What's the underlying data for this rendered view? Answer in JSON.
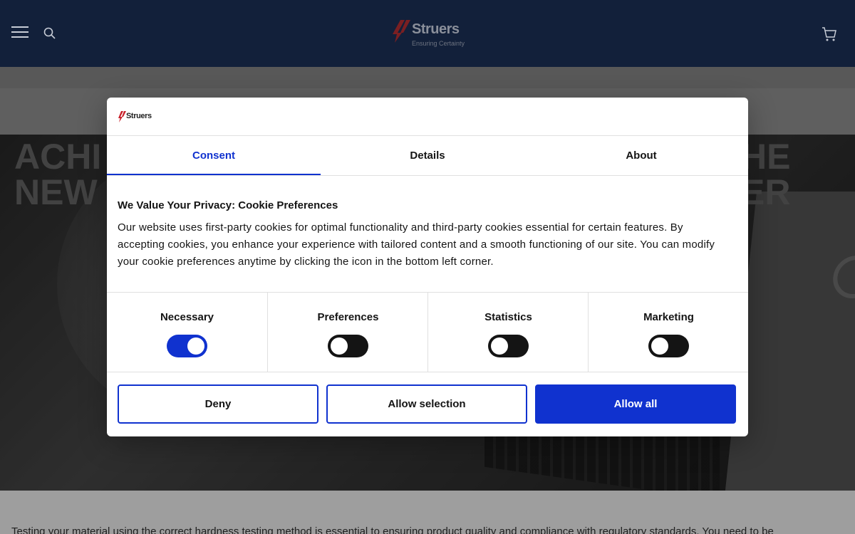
{
  "header": {
    "brand_name": "Struers",
    "brand_tagline": "Ensuring Certainty",
    "menu_icon": "hamburger-menu-icon",
    "search_icon": "search-icon",
    "cart_icon": "shopping-cart-icon",
    "background_color": "#12203a"
  },
  "hero": {
    "title_left_line1": "ACHI",
    "title_left_line2": "NEW",
    "title_right_line1": "HE",
    "title_right_line2": "ER"
  },
  "intro_text": "Testing your material using the correct hardness testing method is essential to ensuring product quality and compliance with regulatory standards. You need to be",
  "consent_dialog": {
    "logo_text": "Struers",
    "tabs": [
      {
        "label": "Consent",
        "active": true
      },
      {
        "label": "Details",
        "active": false
      },
      {
        "label": "About",
        "active": false
      }
    ],
    "title": "We Value Your Privacy: Cookie Preferences",
    "body": "Our website uses first-party cookies for optimal functionality and third-party cookies essential for certain features. By accepting cookies, you enhance your experience with tailored content and a smooth functioning of our site. You can modify your cookie preferences anytime by clicking the icon in the bottom left corner.",
    "categories": [
      {
        "label": "Necessary",
        "checked": true
      },
      {
        "label": "Preferences",
        "checked": false
      },
      {
        "label": "Statistics",
        "checked": false
      },
      {
        "label": "Marketing",
        "checked": false
      }
    ],
    "buttons": {
      "deny": "Deny",
      "allow_selection": "Allow selection",
      "allow_all": "Allow all"
    },
    "accent_color": "#1032cf"
  }
}
